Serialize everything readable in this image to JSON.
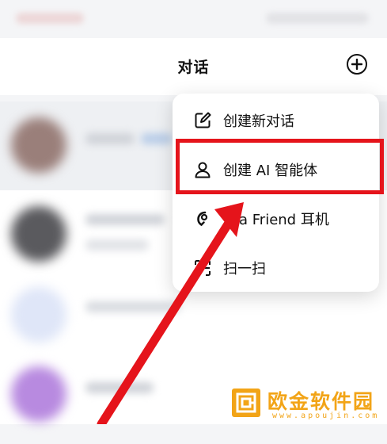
{
  "header": {
    "title": "对话"
  },
  "menu": {
    "items": [
      {
        "label": "创建新对话",
        "icon": "edit-icon"
      },
      {
        "label": "创建 AI 智能体",
        "icon": "person-icon"
      },
      {
        "label": "a Friend 耳机",
        "icon": "earphone-icon"
      },
      {
        "label": "扫一扫",
        "icon": "scan-icon"
      }
    ],
    "highlighted_index": 1
  },
  "watermark": {
    "title": "欧金软件园",
    "subtitle": "www.apoujin.com"
  },
  "colors": {
    "highlight": "#e5141b",
    "watermark": "#f2a417"
  }
}
